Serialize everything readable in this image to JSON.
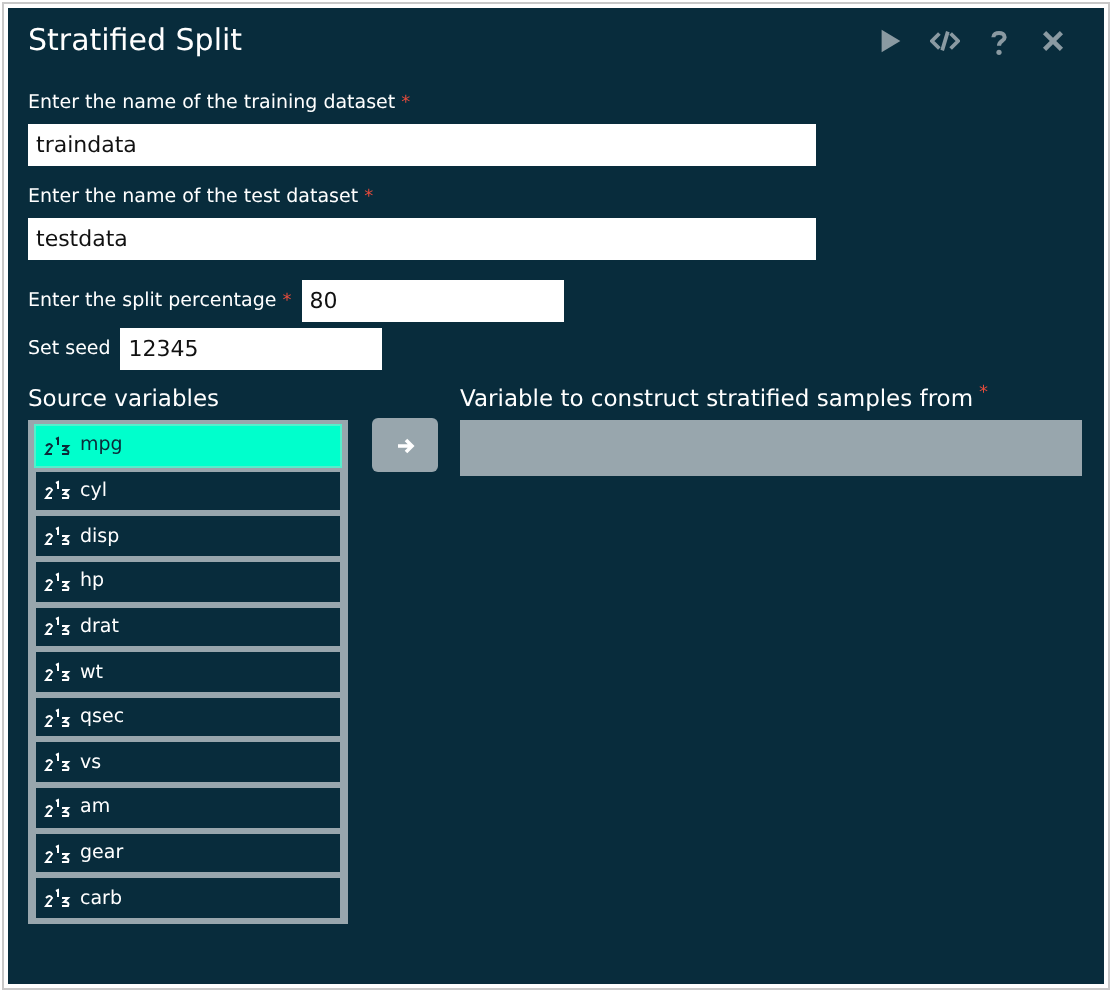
{
  "window": {
    "title": "Stratified Split"
  },
  "toolbar": [
    {
      "kind": "run"
    },
    {
      "kind": "code"
    },
    {
      "kind": "help"
    },
    {
      "kind": "close"
    }
  ],
  "fields": [
    {
      "kind": "wide",
      "label": "Enter the name of the training dataset",
      "required_mark": "*",
      "value": "traindata"
    },
    {
      "kind": "wide",
      "label": "Enter the name of the test dataset",
      "required_mark": "*",
      "value": "testdata"
    },
    {
      "kind": "inline",
      "label": "Enter the split percentage",
      "required_mark": "*",
      "value": "80"
    },
    {
      "kind": "inline_short",
      "label": "Set seed",
      "value": "12345"
    }
  ],
  "source": {
    "title": "Source variables",
    "items": [
      {
        "label": "mpg",
        "selected": true
      },
      {
        "label": "cyl",
        "selected": false
      },
      {
        "label": "disp",
        "selected": false
      },
      {
        "label": "hp",
        "selected": false
      },
      {
        "label": "drat",
        "selected": false
      },
      {
        "label": "wt",
        "selected": false
      },
      {
        "label": "qsec",
        "selected": false
      },
      {
        "label": "vs",
        "selected": false
      },
      {
        "label": "am",
        "selected": false
      },
      {
        "label": "gear",
        "selected": false
      },
      {
        "label": "carb",
        "selected": false
      }
    ]
  },
  "target": {
    "title": "Variable to construct stratified samples from",
    "required_mark": "*"
  }
}
